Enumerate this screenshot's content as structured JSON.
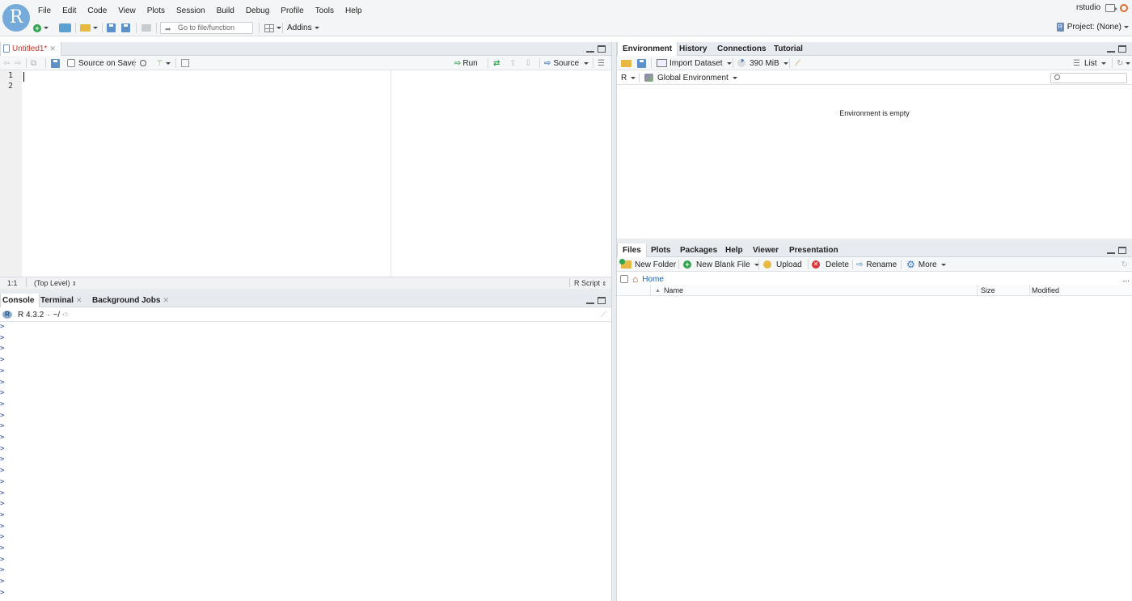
{
  "app": {
    "logo_letter": "R"
  },
  "menu": [
    "File",
    "Edit",
    "Code",
    "View",
    "Plots",
    "Session",
    "Build",
    "Debug",
    "Profile",
    "Tools",
    "Help"
  ],
  "user": {
    "name": "rstudio"
  },
  "toolbar": {
    "goto_placeholder": "Go to file/function",
    "addins_label": "Addins"
  },
  "project": {
    "label": "Project: (None)"
  },
  "editor": {
    "tab_title": "Untitled1*",
    "source_on_save": "Source on Save",
    "run_label": "Run",
    "source_label": "Source",
    "line_numbers": [
      "1",
      "2"
    ],
    "cursor_position": "1:1",
    "scope": "(Top Level)",
    "file_type": "R Script"
  },
  "console_pane": {
    "tabs": [
      "Console",
      "Terminal",
      "Background Jobs"
    ],
    "r_version": "R 4.3.2",
    "working_dir": "~/",
    "prompt_char": ">",
    "prompt_count": 25
  },
  "env_pane": {
    "tabs": [
      "Environment",
      "History",
      "Connections",
      "Tutorial"
    ],
    "import_dataset": "Import Dataset",
    "memory": "390 MiB",
    "list_label": "List",
    "language": "R",
    "env_selector": "Global Environment",
    "empty_message": "Environment is empty"
  },
  "files_pane": {
    "tabs": [
      "Files",
      "Plots",
      "Packages",
      "Help",
      "Viewer",
      "Presentation"
    ],
    "new_folder": "New Folder",
    "new_blank_file": "New Blank File",
    "upload": "Upload",
    "delete": "Delete",
    "rename": "Rename",
    "more": "More",
    "breadcrumb_home": "Home",
    "ellipsis": "...",
    "columns": [
      "Name",
      "Size",
      "Modified"
    ]
  },
  "colors": {
    "accent": "#75aadb",
    "prompt": "#1d3fae",
    "tab_title": "#c0392b"
  }
}
